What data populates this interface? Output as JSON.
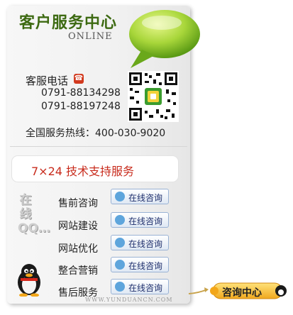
{
  "header": {
    "title": "客户服务中心",
    "subtitle": "ONLINE"
  },
  "contact": {
    "label": "客服电话",
    "phones": [
      "0791-88134298",
      "0791-88197248"
    ],
    "hotline": "全国服务热线：400-030-9020"
  },
  "support_banner": "7×24 技术支持服务",
  "vertical_label": "在线QQ…",
  "services": [
    {
      "label": "售前咨询",
      "button": "在线咨询"
    },
    {
      "label": "网站建设",
      "button": "在线咨询"
    },
    {
      "label": "网站优化",
      "button": "在线咨询"
    },
    {
      "label": "整合营销",
      "button": "在线咨询"
    },
    {
      "label": "售后服务",
      "button": "在线咨询"
    }
  ],
  "footer": {
    "watermark": "WWW.YUNDUANCN.COM",
    "consult_tab": "咨询中心"
  },
  "colors": {
    "title_green": "#3d6a12",
    "banner_red": "#c82b1c",
    "bubble_green": "#8dc21f"
  },
  "icons": [
    "speech-bubble-icon",
    "phone-icon",
    "qr-code",
    "qq-penguin-icon",
    "chat-icon"
  ]
}
